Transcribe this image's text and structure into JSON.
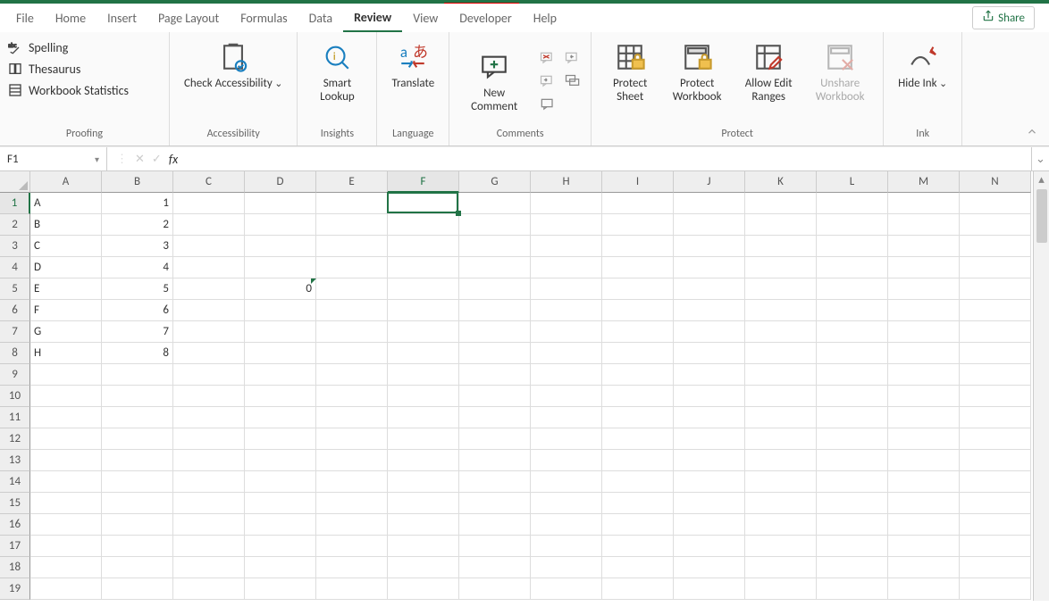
{
  "tabs": {
    "file": "File",
    "home": "Home",
    "insert": "Insert",
    "page_layout": "Page Layout",
    "formulas": "Formulas",
    "data": "Data",
    "review": "Review",
    "view": "View",
    "developer": "Developer",
    "help": "Help"
  },
  "share_label": "Share",
  "ribbon": {
    "proofing": {
      "label": "Proofing",
      "spelling": "Spelling",
      "thesaurus": "Thesaurus",
      "workbook_statistics": "Workbook Statistics"
    },
    "accessibility": {
      "label": "Accessibility",
      "check": "Check Accessibility"
    },
    "insights": {
      "label": "Insights",
      "smart_lookup": "Smart Lookup"
    },
    "language": {
      "label": "Language",
      "translate": "Translate"
    },
    "comments": {
      "label": "Comments",
      "new_comment": "New Comment"
    },
    "protect": {
      "label": "Protect",
      "protect_sheet": "Protect Sheet",
      "protect_workbook": "Protect Workbook",
      "allow_edit_ranges": "Allow Edit Ranges",
      "unshare_workbook": "Unshare Workbook"
    },
    "ink": {
      "label": "Ink",
      "hide_ink": "Hide Ink"
    }
  },
  "name_box": "F1",
  "formula_value": "",
  "columns": [
    "A",
    "B",
    "C",
    "D",
    "E",
    "F",
    "G",
    "H",
    "I",
    "J",
    "K",
    "L",
    "M",
    "N"
  ],
  "rows": [
    1,
    2,
    3,
    4,
    5,
    6,
    7,
    8,
    9,
    10,
    11,
    12,
    13,
    14,
    15,
    16,
    17,
    18,
    19
  ],
  "selected_cell": {
    "col": "F",
    "row": 1
  },
  "data_cells": {
    "A": [
      "A",
      "B",
      "C",
      "D",
      "E",
      "F",
      "G",
      "H"
    ],
    "B": [
      "1",
      "2",
      "3",
      "4",
      "5",
      "6",
      "7",
      "8"
    ],
    "D5": "0"
  },
  "error_indicator": {
    "cell": "D5",
    "present": true
  }
}
